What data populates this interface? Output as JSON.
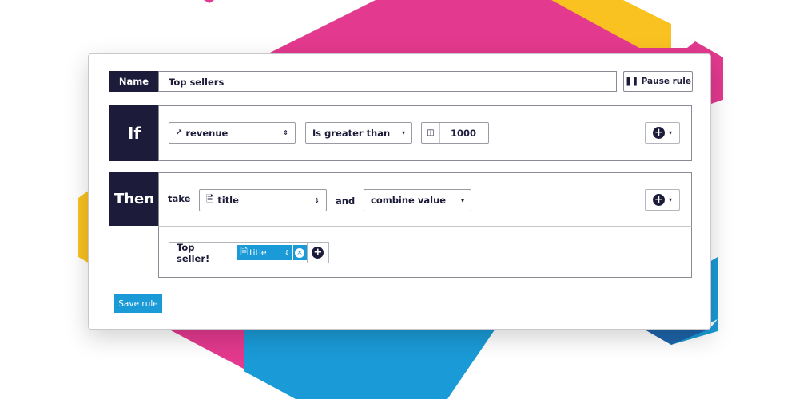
{
  "colors": {
    "pink": "#e3398e",
    "yellow": "#f9c221",
    "blue": "#1a9ad6",
    "navy": "#1c1c3a",
    "dark_blue": "#1d63a8"
  },
  "name": {
    "label": "Name",
    "value": "Top sellers"
  },
  "pause_button": {
    "icon": "pause-icon",
    "label": "Pause rule"
  },
  "if_block": {
    "label": "If",
    "field": {
      "icon": "trend-icon",
      "value": "revenue"
    },
    "operator": "Is greater than",
    "value_icon": "column-icon",
    "value": "1000",
    "add_icon": "plus-circle-icon"
  },
  "then_block": {
    "label": "Then",
    "take_label": "take",
    "field": {
      "icon": "file-icon",
      "value": "title"
    },
    "and_label": "and",
    "action": "combine value",
    "add_icon": "plus-circle-icon"
  },
  "combine": {
    "text": "Top seller!",
    "token": {
      "icon": "file-icon",
      "value": "title"
    }
  },
  "save_button": {
    "label": "Save rule"
  }
}
